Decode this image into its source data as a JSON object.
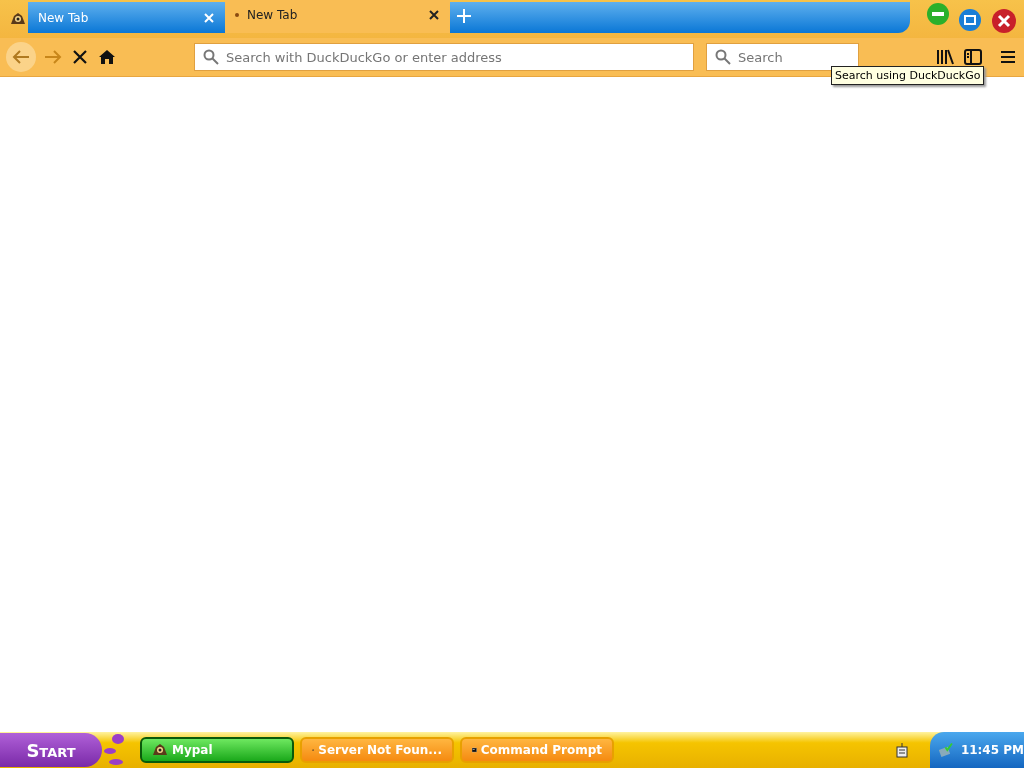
{
  "tabs": [
    {
      "label": "New Tab",
      "selected": false,
      "loading": false
    },
    {
      "label": "New Tab",
      "selected": true,
      "loading": true
    }
  ],
  "address_bar": {
    "placeholder": "Search with DuckDuckGo or enter address"
  },
  "search_bar": {
    "placeholder": "Search"
  },
  "tooltip": "Search using DuckDuckGo",
  "taskbar": {
    "start": "Start",
    "items": [
      {
        "label": "Mypal",
        "selected": true,
        "kind": "browser"
      },
      {
        "label": "Server Not Foun...",
        "selected": false,
        "kind": "browser"
      },
      {
        "label": "Command Prompt",
        "selected": false,
        "kind": "console"
      }
    ],
    "clock": "11:45 PM"
  }
}
